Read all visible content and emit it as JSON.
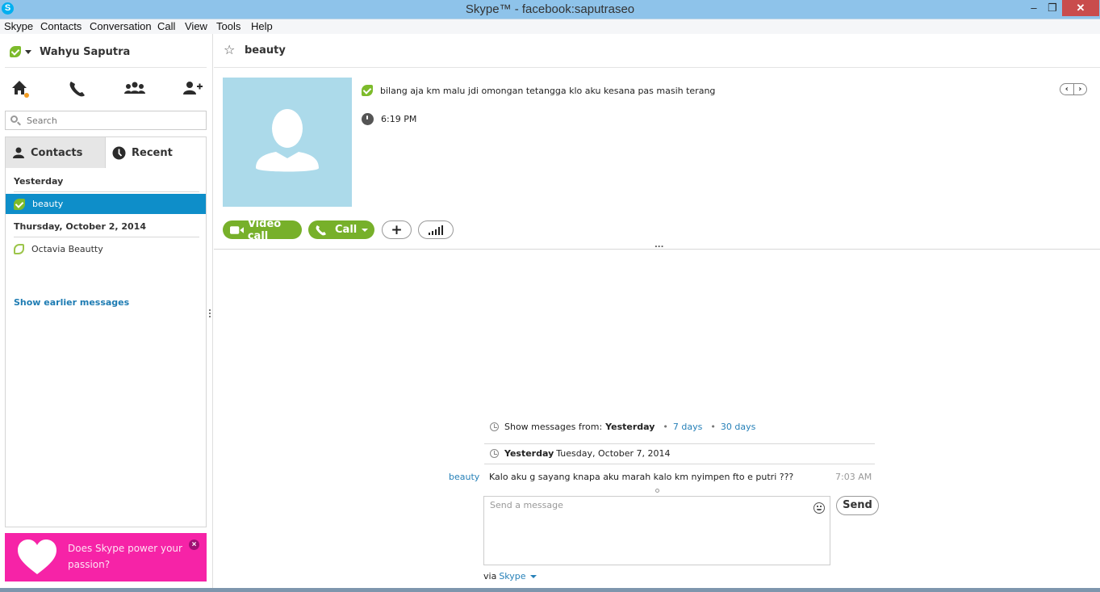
{
  "window": {
    "title": "Skype™ - facebook:saputraseo",
    "app_icon": "S",
    "minimize": "–",
    "maximize": "❐",
    "close": "✕"
  },
  "menu": [
    "Skype",
    "Contacts",
    "Conversation",
    "Call",
    "View",
    "Tools",
    "Help"
  ],
  "sidebar": {
    "profile_name": "Wahyu Saputra",
    "profile_status": "online",
    "nav_icons": [
      "home-icon",
      "phone-icon",
      "group-icon",
      "add-contact-icon"
    ],
    "search_placeholder": "Search",
    "tabs": [
      {
        "label": "Contacts",
        "icon": "person-icon",
        "active": true
      },
      {
        "label": "Recent",
        "icon": "clock-icon",
        "active": false
      }
    ],
    "groups": [
      {
        "header": "Yesterday",
        "items": [
          {
            "name": "beauty",
            "status": "online",
            "selected": true
          }
        ]
      },
      {
        "header": "Thursday, October 2, 2014",
        "items": [
          {
            "name": "Octavia Beautty",
            "status": "away",
            "selected": false
          }
        ]
      }
    ],
    "show_earlier": "Show earlier messages",
    "promo": {
      "text": "Does Skype power your passion?",
      "close": "×",
      "color": "#f623a7"
    }
  },
  "conversation": {
    "contact_name": "beauty",
    "mood_message": "bilang aja km malu jdi omongan tetangga klo aku kesana pas masih terang",
    "local_time": "6:19 PM",
    "pager": {
      "prev": "‹",
      "next": "›"
    },
    "buttons": {
      "video_call": "Video call",
      "call": "Call",
      "add": "+"
    },
    "more": "...",
    "history": {
      "label": "Show messages from:",
      "current": "Yesterday",
      "options": [
        "7 days",
        "30 days"
      ]
    },
    "day_header": {
      "label": "Yesterday",
      "date": "Tuesday, October 7, 2014"
    },
    "messages": [
      {
        "sender": "beauty",
        "text": "Kalo aku g sayang knapa aku marah kalo km nyimpen fto e putri ???",
        "time": "7:03 AM"
      }
    ],
    "compose": {
      "placeholder": "Send a message",
      "value": "",
      "send_label": "Send",
      "via_label": "via",
      "via_service": "Skype"
    }
  },
  "colors": {
    "accent_green": "#77b02a",
    "selected_blue": "#0e8ec9",
    "link_blue": "#2680b8",
    "titlebar": "#8ec3ea",
    "close_red": "#c94c4c"
  }
}
